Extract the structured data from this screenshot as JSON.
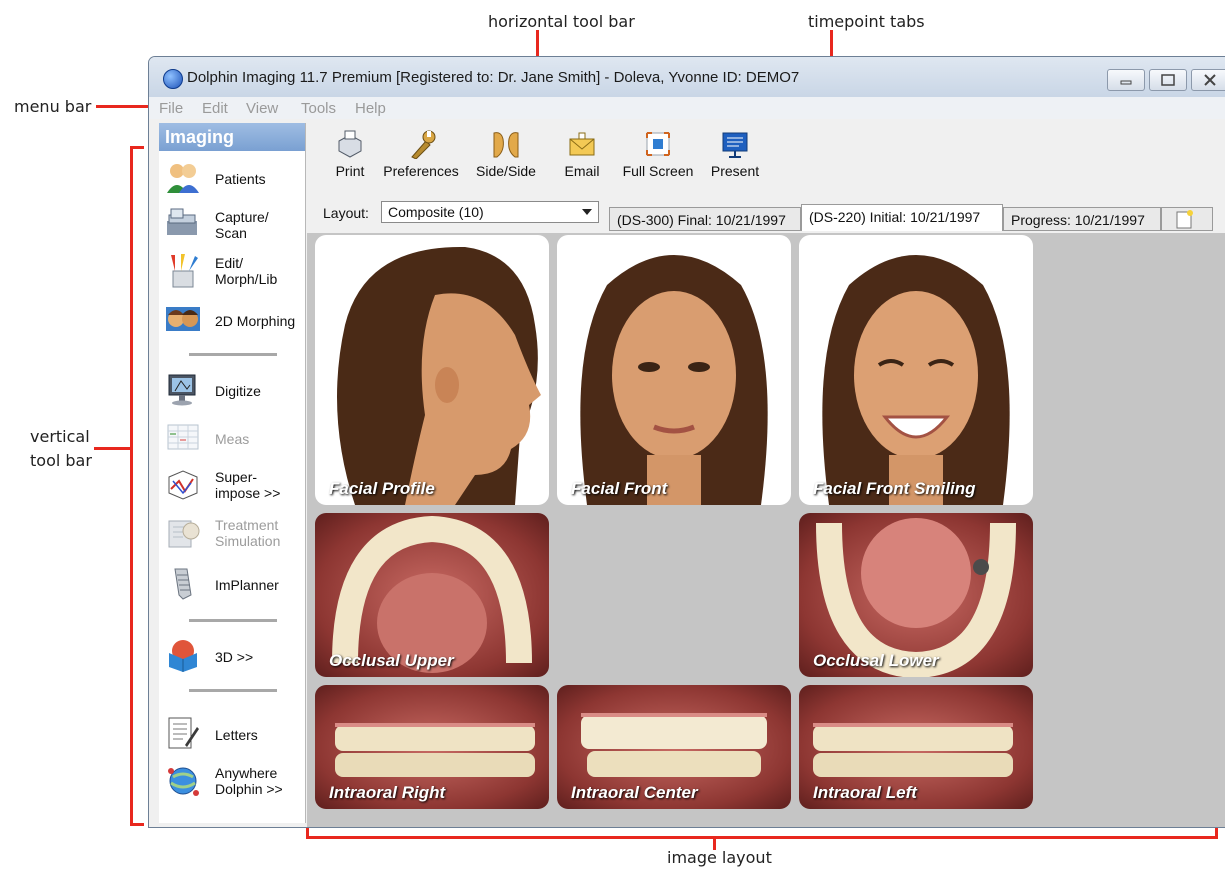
{
  "annotations": {
    "horizontal_tool_bar": "horizontal tool bar",
    "timepoint_tabs": "timepoint tabs",
    "menu_bar": "menu bar",
    "vertical_tool_bar_line1": "vertical",
    "vertical_tool_bar_line2": "tool bar",
    "image_layout": "image layout"
  },
  "window": {
    "title": "Dolphin Imaging 11.7 Premium [Registered to: Dr. Jane Smith] - Doleva, Yvonne  ID: DEMO7"
  },
  "menu": [
    "File",
    "Edit",
    "View",
    "Tools",
    "Help"
  ],
  "sidebar": {
    "header": "Imaging",
    "items": [
      {
        "label": "Patients",
        "icon": "patients-icon"
      },
      {
        "label": "Capture/\nScan",
        "icon": "scanner-icon"
      },
      {
        "label": "Edit/\nMorph/Lib",
        "icon": "pencils-icon"
      },
      {
        "label": "2D Morphing",
        "icon": "morphing-icon"
      },
      {
        "label": "Digitize",
        "icon": "digitize-icon"
      },
      {
        "label": "Meas",
        "icon": "measure-icon"
      },
      {
        "label": "Super-\nimpose >>",
        "icon": "superimpose-icon"
      },
      {
        "label": "Treatment\nSimulation",
        "icon": "treatment-icon"
      },
      {
        "label": "ImPlanner",
        "icon": "implant-icon"
      },
      {
        "label": "3D >>",
        "icon": "3d-cube-icon"
      },
      {
        "label": "Letters",
        "icon": "letters-icon"
      },
      {
        "label": "Anywhere\nDolphin >>",
        "icon": "globe-icon"
      }
    ]
  },
  "toolbar": [
    {
      "label": "Print",
      "icon": "print-icon"
    },
    {
      "label": "Preferences",
      "icon": "wrench-icon"
    },
    {
      "label": "Side/Side",
      "icon": "side-by-side-icon"
    },
    {
      "label": "Email",
      "icon": "email-icon"
    },
    {
      "label": "Full Screen",
      "icon": "full-screen-icon"
    },
    {
      "label": "Present",
      "icon": "present-icon"
    }
  ],
  "layout": {
    "label": "Layout:",
    "selected": "Composite (10)"
  },
  "tabs": [
    {
      "label": "(DS-300) Final: 10/21/1997",
      "active": false
    },
    {
      "label": "(DS-220) Initial: 10/21/1997",
      "active": true
    },
    {
      "label": "Progress: 10/21/1997",
      "active": false
    }
  ],
  "images": [
    {
      "caption": "Facial Profile"
    },
    {
      "caption": "Facial Front"
    },
    {
      "caption": "Facial Front Smiling"
    },
    {
      "caption": "Occlusal Upper"
    },
    {
      "caption": "Occlusal Lower"
    },
    {
      "caption": "Intraoral Right"
    },
    {
      "caption": "Intraoral Center"
    },
    {
      "caption": "Intraoral Left"
    }
  ],
  "colors": {
    "annotation_red": "#e8281e",
    "sidebar_header": "#8cafdd",
    "layout_bg": "#c5c5c5"
  }
}
